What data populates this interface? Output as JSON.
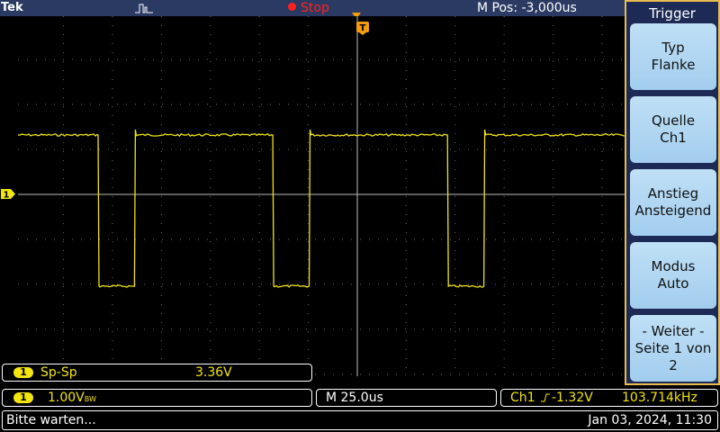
{
  "brand": "Tek",
  "acquisition": {
    "icon": "pulse-icon",
    "state": "Stop",
    "state_color": "#ff2020"
  },
  "horizontal_position": "M Pos: -3,000us",
  "trigger_menu": {
    "title": "Trigger",
    "buttons": [
      {
        "line1": "Typ",
        "line2": "Flanke"
      },
      {
        "line1": "Quelle",
        "line2": "Ch1"
      },
      {
        "line1": "Anstieg",
        "line2": "Ansteigend"
      },
      {
        "line1": "Modus",
        "line2": "Auto"
      },
      {
        "line1": "- Weiter -",
        "line2": "Seite 1 von 2"
      }
    ]
  },
  "channel": {
    "label": "1",
    "color": "#f2e510"
  },
  "measurement": {
    "channel": "1",
    "label": "Sp-Sp",
    "value": "3.36V"
  },
  "vertical_scale": {
    "channel": "1",
    "value": "1.00V",
    "suffix": "BW"
  },
  "timebase": "M 25.0us",
  "trigger_info": {
    "source": "Ch1",
    "level": "-1.32V",
    "frequency": "103.714kHz"
  },
  "status": {
    "message": "Bitte warten...",
    "datetime": "Jan 03, 2024, 11:30"
  },
  "waveform": {
    "color": "#f2e510",
    "high_level_div": 1.32,
    "low_level_div": -2.04,
    "edges_us": [
      -95,
      -80,
      -23,
      -8,
      49,
      64
    ],
    "x_range_us": [
      -128,
      122
    ],
    "time_per_div_us": 25
  }
}
